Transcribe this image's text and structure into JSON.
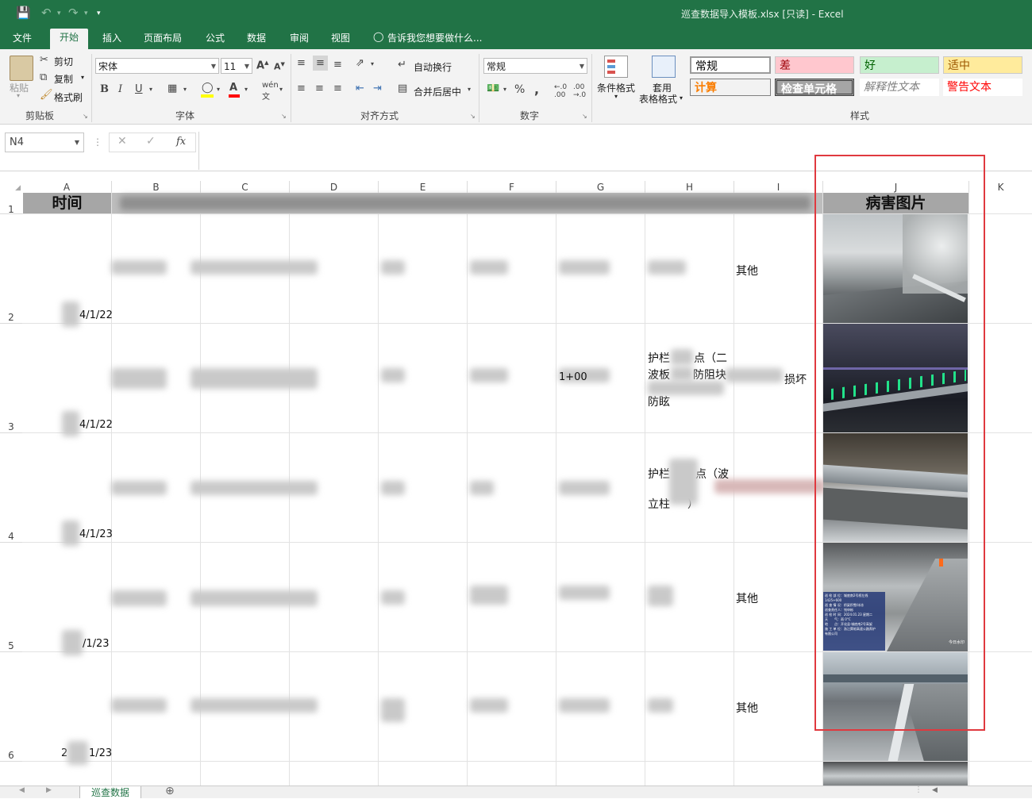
{
  "window": {
    "title": "巡查数据导入模板.xlsx [只读] - Excel"
  },
  "ribbon_tabs": [
    "文件",
    "开始",
    "插入",
    "页面布局",
    "公式",
    "数据",
    "审阅",
    "视图"
  ],
  "tell_me": "告诉我您想要做什么...",
  "clipboard": {
    "paste": "粘贴",
    "cut": "剪切",
    "copy": "复制",
    "format_painter": "格式刷",
    "label": "剪贴板"
  },
  "font": {
    "name": "宋体",
    "size": "11",
    "label": "字体"
  },
  "alignment": {
    "wrap": "自动换行",
    "merge": "合并后居中",
    "label": "对齐方式"
  },
  "number": {
    "format": "常规",
    "label": "数字"
  },
  "styles": {
    "conditional": "条件格式",
    "table_line1": "套用",
    "table_line2": "表格格式",
    "cells": [
      {
        "text": "常规",
        "bg": "#ffffff",
        "color": "#000000"
      },
      {
        "text": "差",
        "bg": "#ffc7ce",
        "color": "#9c0006"
      },
      {
        "text": "好",
        "bg": "#c6efce",
        "color": "#006100"
      },
      {
        "text": "适中",
        "bg": "#ffeb9c",
        "color": "#9c5700"
      },
      {
        "text": "计算",
        "bg": "#f2f2f2",
        "color": "#fa7d00"
      },
      {
        "text": "检查单元格",
        "bg": "#a5a5a5",
        "color": "#ffffff"
      },
      {
        "text": "解释性文本",
        "bg": "#ffffff",
        "color": "#7f7f7f"
      },
      {
        "text": "警告文本",
        "bg": "#ffffff",
        "color": "#ff0000"
      }
    ],
    "label": "样式"
  },
  "formula_bar": {
    "name_box": "N4",
    "fx": "fx"
  },
  "columns": [
    "A",
    "B",
    "C",
    "D",
    "E",
    "F",
    "G",
    "H",
    "I",
    "J",
    "K"
  ],
  "header_row": {
    "a": "时间",
    "j": "病害图片"
  },
  "rows": [
    {
      "num": "2",
      "date": "4/1/22",
      "i": "其他",
      "h": ""
    },
    {
      "num": "3",
      "date": "4/1/22",
      "i": "损坏",
      "h1": "护栏",
      "h2": "点（二",
      "h3": "波板",
      "h4": "防阻块",
      "h5": "防眩",
      "g": "1+00"
    },
    {
      "num": "4",
      "date": "4/1/23",
      "h1": "护栏",
      "h2": "点（波",
      "h3": "立柱",
      "h4": "）"
    },
    {
      "num": "5",
      "date": "/1/23",
      "i": "其他"
    },
    {
      "num": "6",
      "date": "2",
      "date2": "1/23",
      "i": "其他"
    }
  ],
  "photo_overlay": {
    "lines": [
      "巡 检 部 位：城底南2号桥左线",
      "1425+600",
      "巡 查 情 况：桥梁积雪/冰冻",
      "巡查责任人：钱申彬",
      "巡 检 时 间：2024.01.23 星期二",
      "天　　气：雨 0°C",
      "地　　点：开化县·城底南2号高架",
      "施 工 单 位：浙江舜裕高速公路养护",
      "有限公司"
    ],
    "brand": "今日水印"
  },
  "sheet_tab": "巡查数据"
}
